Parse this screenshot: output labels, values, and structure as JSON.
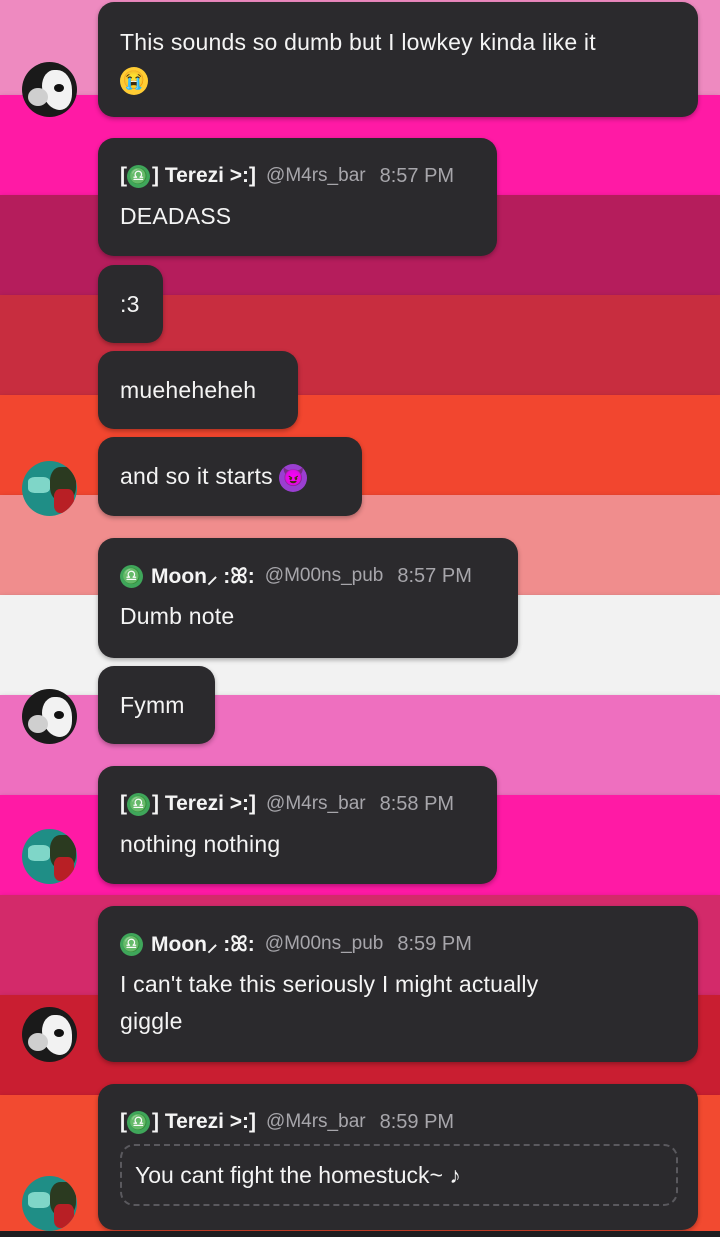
{
  "background": {
    "stripes": [
      "#ee8ac0",
      "#ff1aa5",
      "#b51d5c",
      "#c82d3f",
      "#d24040",
      "#f2462f",
      "#f08d8d",
      "#f2f2f2",
      "#ee6fbf",
      "#ff1aa5",
      "#d32a6a",
      "#c91e31",
      "#f24a30"
    ]
  },
  "messages": [
    {
      "id": "m1",
      "text_line1": "This sounds so dumb but I lowkey kinda like it",
      "emoji": "loudly-crying-face",
      "emoji_glyph": "😭"
    },
    {
      "id": "m2",
      "author_open": "[",
      "author_close": "] Terezi >:]",
      "handle": "@M4rs_bar",
      "time": "8:57 PM",
      "text": "DEADASS"
    },
    {
      "id": "m3",
      "text": ":3"
    },
    {
      "id": "m4",
      "text": "mueheheheh"
    },
    {
      "id": "m5",
      "text": "and so it starts",
      "emoji": "smiling-devil-face",
      "emoji_glyph": "😈"
    },
    {
      "id": "m6",
      "author": "Moon⸝ :ꕤ:",
      "handle": "@M00ns_pub",
      "time": "8:57 PM",
      "text": "Dumb note"
    },
    {
      "id": "m7",
      "text": "Fymm"
    },
    {
      "id": "m8",
      "author_open": "[",
      "author_close": "] Terezi >:]",
      "handle": "@M4rs_bar",
      "time": "8:58 PM",
      "text": "nothing nothing"
    },
    {
      "id": "m9",
      "author": "Moon⸝ :ꕤ:",
      "handle": "@M00ns_pub",
      "time": "8:59 PM",
      "text_line1": "I can't take this seriously I might actually",
      "text_line2": "giggle"
    },
    {
      "id": "m10",
      "author_open": "[",
      "author_close": "] Terezi >:]",
      "handle": "@M4rs_bar",
      "time": "8:59 PM",
      "note": "You cant fight the homestuck~ ♪"
    }
  ],
  "libra_glyph": "♎"
}
